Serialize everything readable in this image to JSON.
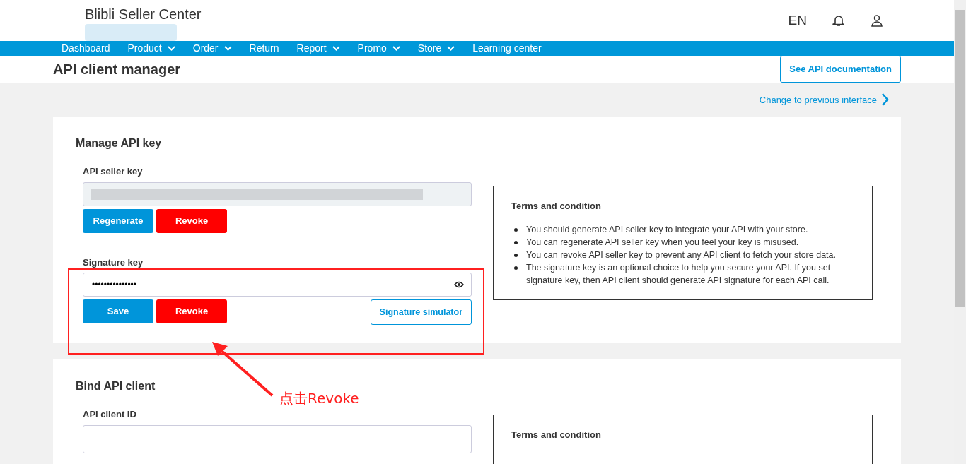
{
  "header": {
    "brand": "Blibli Seller Center",
    "language": "EN"
  },
  "nav": [
    {
      "label": "Dashboard",
      "dropdown": false
    },
    {
      "label": "Product",
      "dropdown": true
    },
    {
      "label": "Order",
      "dropdown": true
    },
    {
      "label": "Return",
      "dropdown": false
    },
    {
      "label": "Report",
      "dropdown": true
    },
    {
      "label": "Promo",
      "dropdown": true
    },
    {
      "label": "Store",
      "dropdown": true
    },
    {
      "label": "Learning center",
      "dropdown": false
    }
  ],
  "page": {
    "title": "API client manager",
    "doc_button": "See API documentation",
    "previous_link": "Change to previous interface"
  },
  "manage": {
    "title": "Manage API key",
    "seller_key_label": "API seller key",
    "seller_buttons": [
      "Regenerate",
      "Revoke"
    ],
    "signature_label": "Signature key",
    "signature_value": "•••••••••••••••",
    "signature_buttons": [
      "Save",
      "Revoke"
    ],
    "simulator_button": "Signature simulator",
    "terms_title": "Terms and condition",
    "terms": [
      "You should generate API seller key to integrate your API with your store.",
      "You can regenerate API seller key when you feel your key is misused.",
      "You can revoke API seller key to prevent any API client to fetch your store data.",
      "The signature key is an optional choice to help you secure your API. If you set signature key, then API client should generate API signature for each API call."
    ]
  },
  "bind": {
    "title": "Bind API client",
    "client_label": "API client ID",
    "terms_title": "Terms and condition"
  },
  "annotation": {
    "text": "点击Revoke"
  }
}
